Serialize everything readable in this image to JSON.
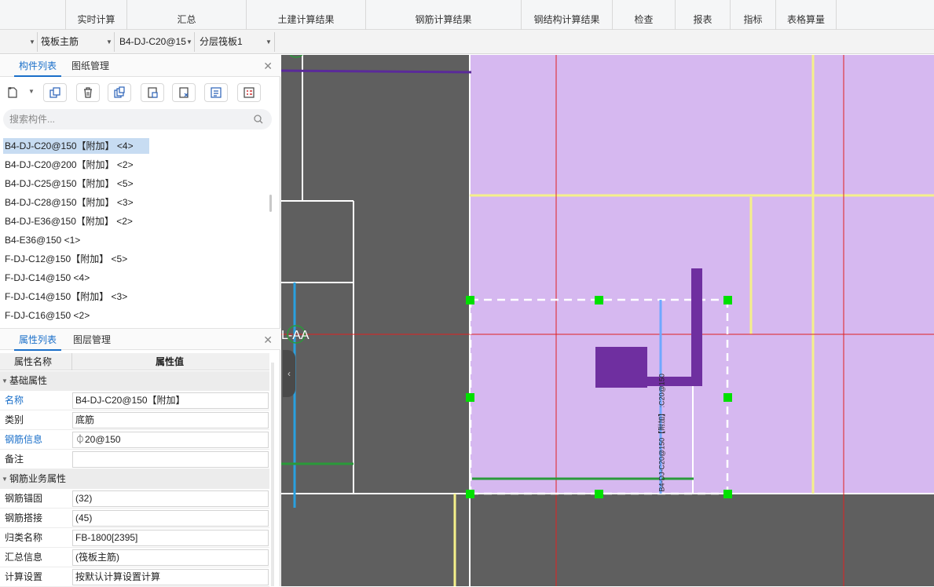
{
  "ribbon": {
    "tabs": [
      "实时计算",
      "汇总",
      "土建计算结果",
      "钢筋计算结果",
      "钢结构计算结果",
      "检查",
      "报表",
      "指标",
      "表格算量"
    ]
  },
  "selectors": {
    "first": "",
    "slab_type": "筏板主筋",
    "component": "B4-DJ-C20@15",
    "layer": "分层筏板1"
  },
  "component_panel": {
    "tab_components": "构件列表",
    "tab_drawings": "图纸管理",
    "search_placeholder": "搜索构件...",
    "tools": [
      "new-icon",
      "copy-icon",
      "delete-icon",
      "duplicate-icon",
      "layer-copy-icon",
      "floor-copy-icon",
      "list-icon",
      "table-icon"
    ],
    "items": [
      "B4-DJ-C20@150【附加】 <4>",
      "B4-DJ-C20@200【附加】 <2>",
      "B4-DJ-C25@150【附加】 <5>",
      "B4-DJ-C28@150【附加】 <3>",
      "B4-DJ-E36@150【附加】 <2>",
      "B4-E36@150 <1>",
      "F-DJ-C12@150【附加】 <5>",
      "F-DJ-C14@150 <4>",
      "F-DJ-C14@150【附加】 <3>",
      "F-DJ-C16@150 <2>"
    ],
    "selected_index": 0
  },
  "property_panel": {
    "tab_properties": "属性列表",
    "tab_layers": "图层管理",
    "col_name": "属性名称",
    "col_value": "属性值",
    "group_basic": "基础属性",
    "group_business": "钢筋业务属性",
    "rows": [
      {
        "name": "名称",
        "value": "B4-DJ-C20@150【附加】",
        "blue": true
      },
      {
        "name": "类别",
        "value": "底筋",
        "blue": false
      },
      {
        "name": "钢筋信息",
        "value": "⏀20@150",
        "blue": true
      },
      {
        "name": "备注",
        "value": "",
        "blue": false
      }
    ],
    "business_rows": [
      {
        "name": "钢筋锚固",
        "value": "(32)"
      },
      {
        "name": "钢筋搭接",
        "value": "(45)"
      },
      {
        "name": "归类名称",
        "value": "FB-1800[2395]"
      },
      {
        "name": "汇总信息",
        "value": "(筏板主筋)"
      },
      {
        "name": "计算设置",
        "value": "按默认计算设置计算"
      }
    ]
  },
  "canvas": {
    "axis_label": "L-AA",
    "rebar_annotation": "B4-DJ-C20@150【附加】 :C20@150",
    "colors": {
      "background": "#5f5f5f",
      "slab": "#d6b8f0",
      "grid_red": "#e02020",
      "yellow": "#f4f08a",
      "purple": "#6f2fa0",
      "handle": "#00e000",
      "blue_line": "#6fa8ff",
      "green_line": "#2a9a3a"
    }
  }
}
